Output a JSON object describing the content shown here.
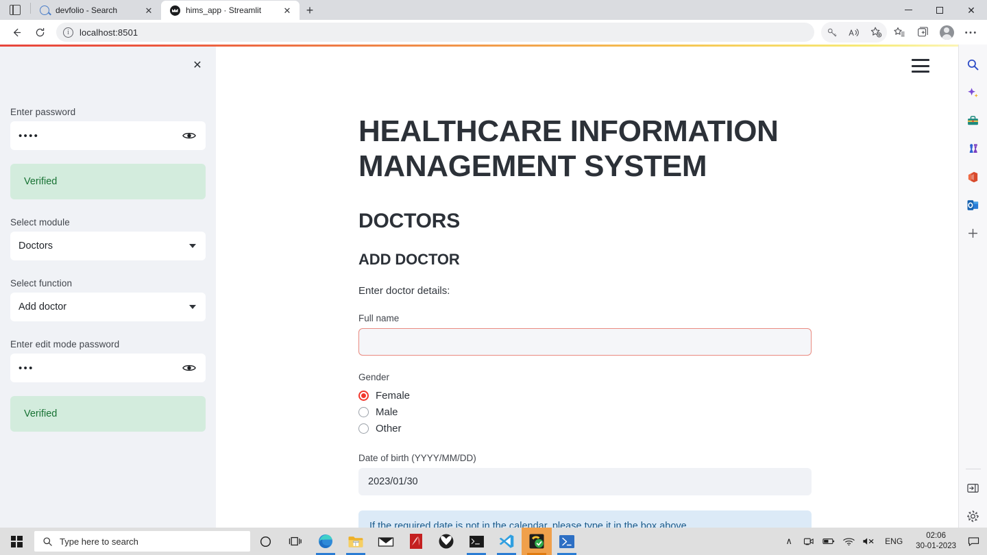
{
  "browser": {
    "tabs": [
      {
        "title": "devfolio - Search",
        "favicon": "search-icon",
        "active": false
      },
      {
        "title": "hims_app · Streamlit",
        "favicon": "streamlit-icon",
        "active": true
      }
    ],
    "new_tab_label": "+",
    "tab_close_label": "✕",
    "address": {
      "url": "localhost:8501",
      "info_glyph": "i"
    },
    "nav": {
      "back": "←",
      "reload": "⟳"
    },
    "window_controls": {
      "minimize": "minimize",
      "maximize": "maximize",
      "close": "✕"
    },
    "toolbar_icons": [
      "key-icon",
      "read-aloud-icon",
      "add-favorite-icon",
      "favorites-icon",
      "collections-icon",
      "profile-avatar",
      "settings-more-icon"
    ]
  },
  "streamlit": {
    "sidebar": {
      "close_label": "✕",
      "password": {
        "label": "Enter password",
        "value": "••••",
        "status": "Verified"
      },
      "module": {
        "label": "Select module",
        "value": "Doctors"
      },
      "function": {
        "label": "Select function",
        "value": "Add doctor"
      },
      "edit_password": {
        "label": "Enter edit mode password",
        "value": "•••",
        "status": "Verified"
      }
    },
    "main": {
      "app_title": "HEALTHCARE INFORMATION MANAGEMENT SYSTEM",
      "section_title": "DOCTORS",
      "sub_title": "ADD DOCTOR",
      "intro_text": "Enter doctor details:",
      "full_name": {
        "label": "Full name",
        "value": "",
        "placeholder": ""
      },
      "gender": {
        "label": "Gender",
        "options": [
          "Female",
          "Male",
          "Other"
        ],
        "selected": "Female"
      },
      "dob": {
        "label": "Date of birth (YYYY/MM/DD)",
        "value": "2023/01/30"
      },
      "info_note": "If the required date is not in the calendar, please type it in the box above.",
      "hamburger": "main-menu-icon"
    },
    "colors": {
      "sidebar_bg": "#f0f2f6",
      "success_bg": "#d3ecdd",
      "success_text": "#177233",
      "info_bg": "#dceaf7",
      "info_text": "#1a5a8a",
      "accent_red": "#f2372c",
      "input_error_border": "#e9897f",
      "heading": "#2c3138"
    }
  },
  "edge_sidebar": {
    "items": [
      "search-icon",
      "copilot-icon",
      "shopping-icon",
      "games-icon",
      "office-icon",
      "outlook-icon",
      "add-tool-icon"
    ],
    "bottom_items": [
      "sidebar-toggle-icon",
      "settings-gear-icon"
    ]
  },
  "taskbar": {
    "start": "windows-start-icon",
    "search_placeholder": "Type here to search",
    "cortana": "cortana-icon",
    "task_view": "task-view-icon",
    "apps": [
      "edge-icon",
      "file-explorer-icon",
      "mail-icon",
      "adobe-icon",
      "xbox-icon",
      "terminal-icon",
      "vscode-icon",
      "app-active-icon",
      "powershell-icon"
    ],
    "tray": {
      "chevron": "∧",
      "icons": [
        "camera-icon",
        "battery-icon",
        "wifi-icon",
        "volume-muted-icon"
      ],
      "language": "ENG",
      "time": "02:06",
      "date": "30-01-2023",
      "notifications": "notification-icon"
    }
  }
}
